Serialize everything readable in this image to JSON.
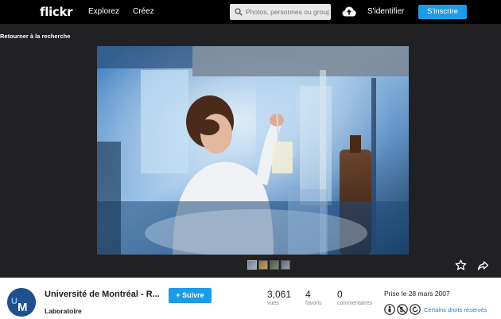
{
  "nav": {
    "logo": "flickr",
    "explore": "Explorez",
    "create": "Créez",
    "search_placeholder": "Photos, personnes ou groupes",
    "signin": "S'identifier",
    "signup": "S'inscrire"
  },
  "back_link": "Retourner à la recherche",
  "photo": {
    "owner": "Université de Montréal - R...",
    "follow_label": "+ Suivre",
    "title": "Laboratoire",
    "avatar_text": "UM"
  },
  "stats": {
    "views": {
      "value": "3,061",
      "label": "vues"
    },
    "faves": {
      "value": "4",
      "label": "favoris"
    },
    "comments": {
      "value": "0",
      "label": "commentaires"
    }
  },
  "taken": "Prise le 28 mars 2007",
  "license": {
    "text": "Certains droits réservés",
    "icons": [
      "cc-by-icon",
      "cc-nc-icon",
      "cc-sa-icon"
    ]
  },
  "colors": {
    "accent": "#1c9be7",
    "nav_bg": "#000000",
    "page_bg": "#212124",
    "link": "#1c7ed6"
  }
}
